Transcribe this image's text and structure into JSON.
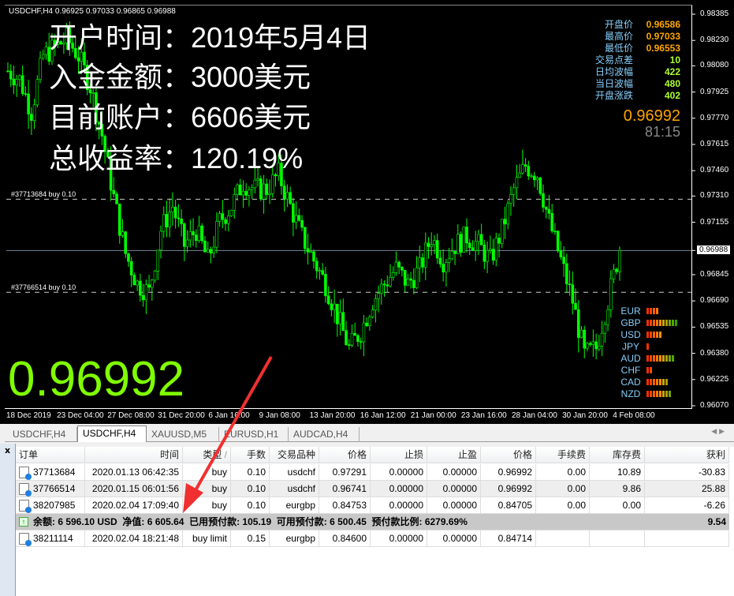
{
  "chart": {
    "symbol_line": "USDCHF,H4  0.96925 0.97033 0.96865 0.96988",
    "overlay": [
      "开户时间：2019年5月4日",
      "入金金额：3000美元",
      "目前账户：6606美元",
      "总收益率：120.19%"
    ],
    "big_price": "0.96992",
    "price_axis": [
      "0.98385",
      "0.98230",
      "0.98080",
      "0.97925",
      "0.97770",
      "0.97615",
      "0.97460",
      "0.97310",
      "0.97155",
      "0.96988",
      "0.96845",
      "0.96690",
      "0.96535",
      "0.96380",
      "0.96225",
      "0.96070"
    ],
    "current_price_label": "0.96988",
    "date_axis": [
      "18 Dec 2019",
      "23 Dec 04:00",
      "27 Dec 08:00",
      "31 Dec 20:00",
      "6 Jan 16:00",
      "9 Jan 08:00",
      "13 Jan 20:00",
      "16 Jan 12:00",
      "21 Jan 00:00",
      "23 Jan 16:00",
      "28 Jan 04:00",
      "30 Jan 20:00",
      "4 Feb 08:00"
    ],
    "order_lines": [
      {
        "label": "#37713684 buy 0.10",
        "price": 0.97291
      },
      {
        "label": "#37766514 buy 0.10",
        "price": 0.96741
      }
    ],
    "price_range": [
      0.9607,
      0.98385
    ],
    "approx_closes": [
      0.9805,
      0.98,
      0.9781,
      0.9814,
      0.9819,
      0.9824,
      0.9814,
      0.9796,
      0.9767,
      0.973,
      0.9697,
      0.9679,
      0.9674,
      0.9711,
      0.9725,
      0.9702,
      0.9711,
      0.9693,
      0.9716,
      0.9725,
      0.9739,
      0.9735,
      0.9735,
      0.9744,
      0.9725,
      0.9707,
      0.9693,
      0.9679,
      0.966,
      0.9641,
      0.9651,
      0.9669,
      0.9679,
      0.9688,
      0.9679,
      0.9688,
      0.9707,
      0.9693,
      0.9702,
      0.9707,
      0.9702,
      0.9693,
      0.9711,
      0.9735,
      0.9749,
      0.9744,
      0.9716,
      0.9693,
      0.9669,
      0.9637,
      0.9641,
      0.9669,
      0.9699
    ],
    "info": [
      {
        "k": "开盘价",
        "v": "0.96586",
        "color": "#ffa500"
      },
      {
        "k": "最高价",
        "v": "0.97033",
        "color": "#ffa500"
      },
      {
        "k": "最低价",
        "v": "0.96553",
        "color": "#ffa500"
      },
      {
        "k": "交易点差",
        "v": "10",
        "color": "#adff2f"
      },
      {
        "k": "日均波幅",
        "v": "422",
        "color": "#adff2f"
      },
      {
        "k": "当日波幅",
        "v": "480",
        "color": "#adff2f"
      },
      {
        "k": "开盘涨跌",
        "v": "402",
        "color": "#adff2f"
      }
    ],
    "current_price": "0.96992",
    "timer": "81:15",
    "strength": [
      {
        "c": "EUR",
        "n": 4
      },
      {
        "c": "GBP",
        "n": 10
      },
      {
        "c": "USD",
        "n": 5
      },
      {
        "c": "JPY",
        "n": 1
      },
      {
        "c": "AUD",
        "n": 9
      },
      {
        "c": "CHF",
        "n": 2
      },
      {
        "c": "CAD",
        "n": 7
      },
      {
        "c": "NZD",
        "n": 8
      }
    ],
    "candle_color": "#00ff00"
  },
  "tabs": [
    {
      "label": "USDCHF,H4",
      "active": false
    },
    {
      "label": "USDCHF,H4",
      "active": true
    },
    {
      "label": "XAUUSD,M5",
      "active": false
    },
    {
      "label": "EURUSD,H1",
      "active": false
    },
    {
      "label": "AUDCAD,H4",
      "active": false
    }
  ],
  "terminal": {
    "close": "x",
    "headers": [
      "订单",
      "时间",
      "类型",
      "手数",
      "交易品种",
      "价格",
      "止损",
      "止盈",
      "价格",
      "手续费",
      "库存费",
      "获利"
    ],
    "sort_indicator": "/",
    "rows": [
      [
        "37713684",
        "2020.01.13 06:42:35",
        "buy",
        "0.10",
        "usdchf",
        "0.97291",
        "0.00000",
        "0.00000",
        "0.96992",
        "0.00",
        "10.89",
        "-30.83"
      ],
      [
        "37766514",
        "2020.01.15 06:01:56",
        "buy",
        "0.10",
        "usdchf",
        "0.96741",
        "0.00000",
        "0.00000",
        "0.96992",
        "0.00",
        "9.86",
        "25.88"
      ],
      [
        "38207985",
        "2020.02.04 17:09:40",
        "buy",
        "0.10",
        "eurgbp",
        "0.84753",
        "0.00000",
        "0.00000",
        "0.84705",
        "0.00",
        "0.00",
        "-6.26"
      ]
    ],
    "summary": {
      "text": "余额: 6 596.10 USD  净值: 6 605.64  已用预付款: 105.19  可用预付款: 6 500.45  预付款比例: 6279.69%",
      "profit": "9.54"
    },
    "pending": [
      "38211114",
      "2020.02.04 18:21:48",
      "buy limit",
      "0.15",
      "eurgbp",
      "0.84600",
      "0.00000",
      "0.00000",
      "0.84714",
      "",
      "",
      ""
    ]
  }
}
